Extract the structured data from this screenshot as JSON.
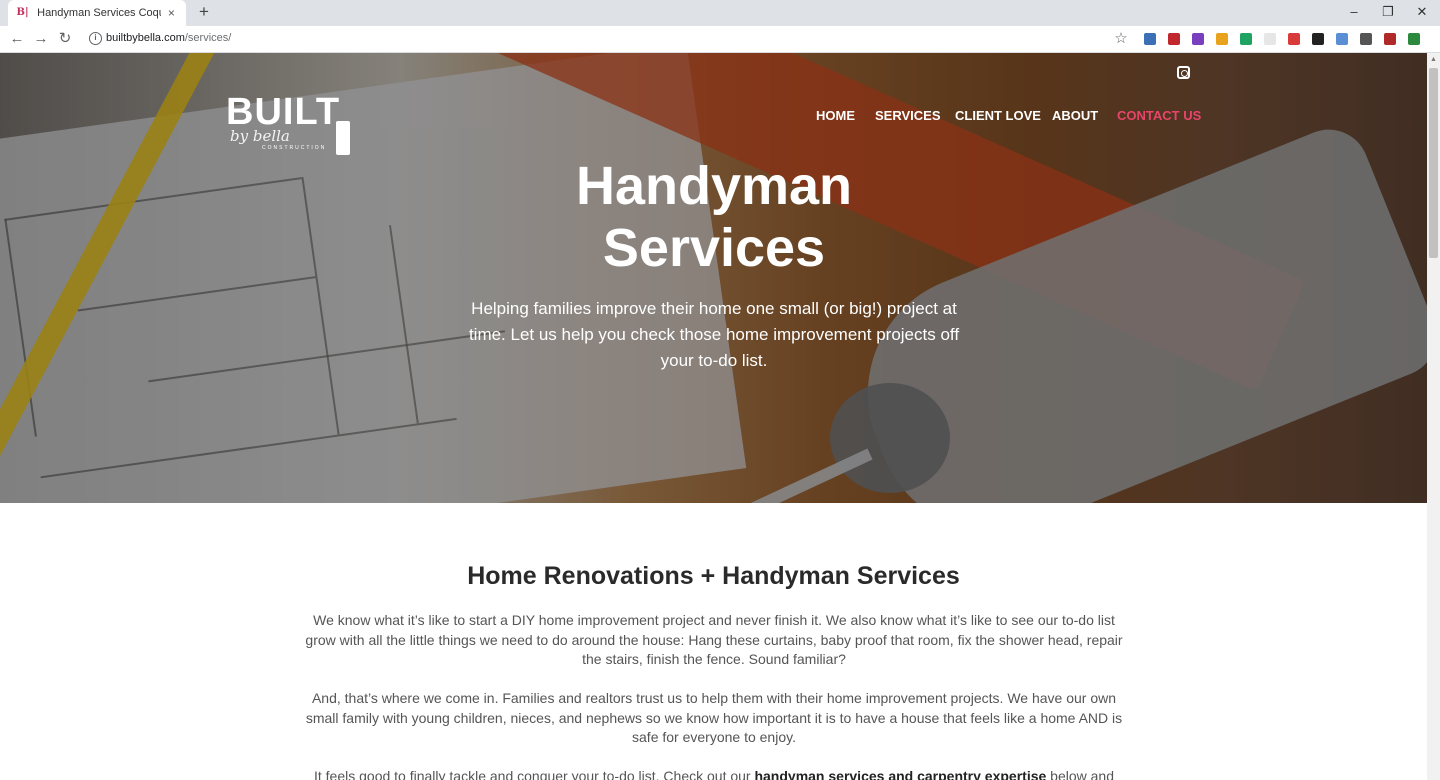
{
  "browser": {
    "tab_title": "Handyman Services Coquitlam | B",
    "tab_favicon": "B|",
    "tab_close": "×",
    "new_tab": "+",
    "url_domain": "builtbybella.com",
    "url_path": "/services/",
    "window_minimize": "–",
    "window_restore": "❐",
    "window_close": "✕",
    "back": "←",
    "forward": "→",
    "reload": "↻",
    "bookmark_star": "☆",
    "extension_colors": [
      "#3b6fb6",
      "#c0282d",
      "#7a3fbf",
      "#e8a21c",
      "#1ea362",
      "#e6e6e6",
      "#d93b3b",
      "#222222",
      "#5a8fd6",
      "#555555",
      "#b02a2a",
      "#2b8a3e"
    ]
  },
  "site": {
    "logo": {
      "word": "BUILT",
      "script": "by bella",
      "sub": "CONSTRUCTION"
    },
    "nav": [
      {
        "label": "HOME",
        "active": false
      },
      {
        "label": "SERVICES",
        "active": false
      },
      {
        "label": "CLIENT LOVE",
        "active": false
      },
      {
        "label": "ABOUT",
        "active": false
      },
      {
        "label": "CONTACT US",
        "active": true
      }
    ],
    "nav_accent": "#e8456b",
    "hero": {
      "title_line1": "Handyman",
      "title_line2": "Services",
      "subtitle": "Helping families improve their home one small (or big!) project at time. Let us help you check those home improvement projects off your to-do list."
    },
    "content": {
      "heading": "Home Renovations + Handyman Services",
      "para1": "We know what it’s like to start a DIY home improvement project and never finish it. We also know what it’s like to see our to-do list grow with all the little things we need to do around the house: Hang these curtains, baby proof that room, fix the shower head, repair the stairs, finish the fence. Sound familiar?",
      "para2": "And, that’s where we come in. Families and realtors trust us to help them with their home improvement projects. We have our own small family with young children, nieces, and nephews so we know how important it is to have a house that feels like a home AND is safe for everyone to enjoy.",
      "para3_start": "It feels good to finally tackle and conquer your to-do list. Check out our ",
      "para3_bold": "handyman services and carpentry expertise",
      "para3_end": " below and let’s get"
    }
  }
}
